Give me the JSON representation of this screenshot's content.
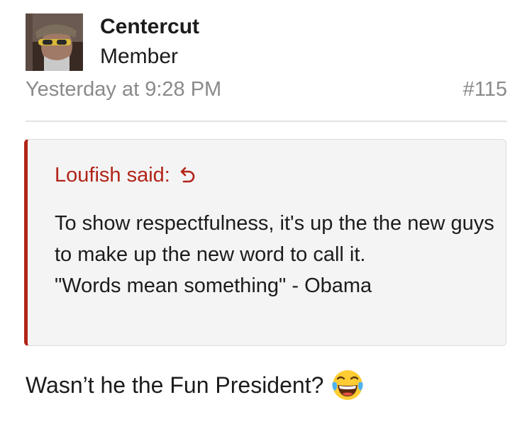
{
  "post": {
    "author": "Centercut",
    "user_title": "Member",
    "date": "Yesterday at 9:28 PM",
    "post_number": "#115",
    "avatar_icon": "user-avatar-photo"
  },
  "quote": {
    "attribution": "Loufish said:",
    "jump_icon": "jump-to-quote-arrow-icon",
    "lines": [
      "To show respectfulness, it's up the the new guys to make up the new word to call it.",
      "\"Words mean something\" - Obama"
    ],
    "accent_color": "#b22418"
  },
  "message": {
    "text": "Wasn’t he the Fun President?",
    "emoji_icon": "laughing-tears-emoji-icon"
  }
}
